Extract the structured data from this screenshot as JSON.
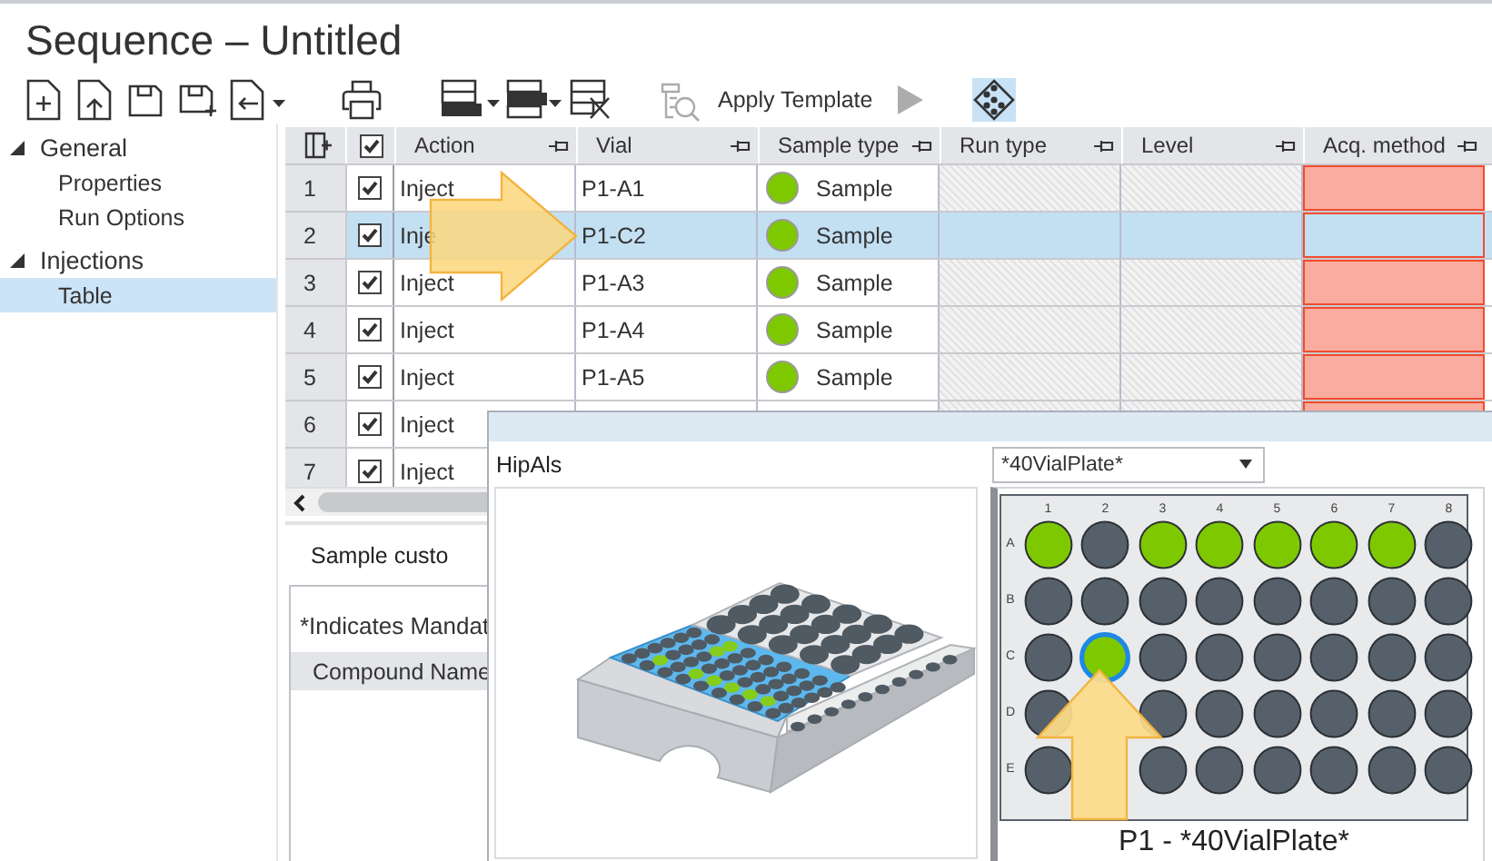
{
  "window": {
    "title": "Sequence – Untitled"
  },
  "toolbar": [
    {
      "disabled": false,
      "selected": false
    },
    {
      "disabled": false,
      "selected": false
    },
    {
      "disabled": false,
      "selected": false
    },
    {
      "disabled": false,
      "selected": false
    },
    {
      "disabled": false,
      "selected": false
    },
    {
      "disabled": false,
      "selected": false
    },
    {
      "disabled": false,
      "selected": false
    },
    {
      "disabled": false,
      "selected": false
    },
    {
      "disabled": false,
      "selected": false
    },
    {
      "label": "Apply Template",
      "disabled": false,
      "selected": false
    },
    {
      "disabled": true,
      "selected": false
    },
    {
      "disabled": false,
      "selected": true
    }
  ],
  "nav": [
    {
      "label": "General",
      "expanded": true,
      "selected": false,
      "children": [
        {
          "label": "Properties",
          "selected": false
        },
        {
          "label": "Run Options",
          "selected": false
        }
      ]
    },
    {
      "label": "Injections",
      "expanded": true,
      "selected": false,
      "children": [
        {
          "label": "Table",
          "selected": true
        }
      ]
    }
  ],
  "table": {
    "all_checked": true,
    "columns": [
      {
        "label": "Action",
        "kind": "text"
      },
      {
        "label": "Vial",
        "kind": "text"
      },
      {
        "label": "Sample type",
        "kind": "sample"
      },
      {
        "label": "Run type",
        "kind": "readonly"
      },
      {
        "label": "Level",
        "kind": "readonly"
      },
      {
        "label": "Acq. method",
        "kind": "missing"
      }
    ],
    "rows": [
      {
        "number": "1",
        "checked": true,
        "selected": false,
        "cells": [
          "Inject",
          "P1-A1",
          "Sample"
        ]
      },
      {
        "number": "2",
        "checked": true,
        "selected": true,
        "cells": [
          "Inje",
          "P1-C2",
          "Sample"
        ]
      },
      {
        "number": "3",
        "checked": true,
        "selected": false,
        "cells": [
          "Inject",
          "P1-A3",
          "Sample"
        ]
      },
      {
        "number": "4",
        "checked": true,
        "selected": false,
        "cells": [
          "Inject",
          "P1-A4",
          "Sample"
        ]
      },
      {
        "number": "5",
        "checked": true,
        "selected": false,
        "cells": [
          "Inject",
          "P1-A5",
          "Sample"
        ]
      },
      {
        "number": "6",
        "checked": true,
        "selected": false,
        "cells": [
          "Inject"
        ]
      },
      {
        "number": "7",
        "checked": true,
        "selected": false,
        "cells": [
          "Inject"
        ]
      }
    ]
  },
  "details": {
    "tab": "Sample custo",
    "note": "*Indicates Mandat",
    "columns": [
      "Compound Name"
    ]
  },
  "vial_popup": {
    "autosampler": "HipAls",
    "plate_type": "*40VialPlate*",
    "caption": "P1 - *40VialPlate*",
    "plate": {
      "columns": [
        "1",
        "2",
        "3",
        "4",
        "5",
        "6",
        "7",
        "8"
      ],
      "rows": [
        {
          "label": "A",
          "wells": [
            {
              "filled": true,
              "selected": false
            },
            {
              "filled": false,
              "selected": false
            },
            {
              "filled": true,
              "selected": false
            },
            {
              "filled": true,
              "selected": false
            },
            {
              "filled": true,
              "selected": false
            },
            {
              "filled": true,
              "selected": false
            },
            {
              "filled": true,
              "selected": false
            },
            {
              "filled": false,
              "selected": false
            }
          ]
        },
        {
          "label": "B",
          "wells": [
            {
              "filled": false,
              "selected": false
            },
            {
              "filled": false,
              "selected": false
            },
            {
              "filled": false,
              "selected": false
            },
            {
              "filled": false,
              "selected": false
            },
            {
              "filled": false,
              "selected": false
            },
            {
              "filled": false,
              "selected": false
            },
            {
              "filled": false,
              "selected": false
            },
            {
              "filled": false,
              "selected": false
            }
          ]
        },
        {
          "label": "C",
          "wells": [
            {
              "filled": false,
              "selected": false
            },
            {
              "filled": true,
              "selected": true
            },
            {
              "filled": false,
              "selected": false
            },
            {
              "filled": false,
              "selected": false
            },
            {
              "filled": false,
              "selected": false
            },
            {
              "filled": false,
              "selected": false
            },
            {
              "filled": false,
              "selected": false
            },
            {
              "filled": false,
              "selected": false
            }
          ]
        },
        {
          "label": "D",
          "wells": [
            {
              "filled": false,
              "selected": false
            },
            {
              "covered": true
            },
            {
              "filled": false,
              "selected": false
            },
            {
              "filled": false,
              "selected": false
            },
            {
              "filled": false,
              "selected": false
            },
            {
              "filled": false,
              "selected": false
            },
            {
              "filled": false,
              "selected": false
            },
            {
              "filled": false,
              "selected": false
            }
          ]
        },
        {
          "label": "E",
          "wells": [
            {
              "filled": false,
              "selected": false
            },
            {
              "covered": true
            },
            {
              "filled": false,
              "selected": false
            },
            {
              "filled": false,
              "selected": false
            },
            {
              "filled": false,
              "selected": false
            },
            {
              "filled": false,
              "selected": false
            },
            {
              "filled": false,
              "selected": false
            },
            {
              "filled": false,
              "selected": false
            }
          ]
        }
      ]
    }
  }
}
